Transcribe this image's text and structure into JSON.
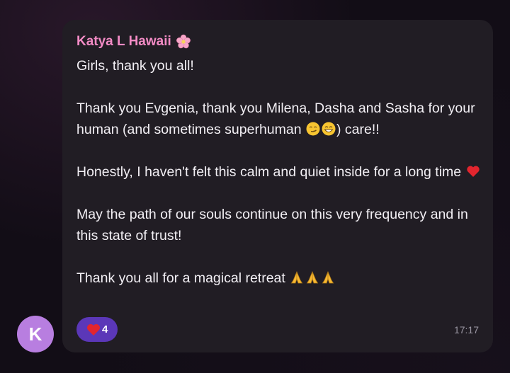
{
  "message": {
    "sender": "Katya L Hawaii",
    "sender_color": "#f38bc5",
    "sender_emoji_icon": "cherry-blossom-icon",
    "avatar_letter": "K",
    "avatar_color": "#b87ee0",
    "paragraphs": {
      "p1": "Girls, thank you all!",
      "p2a": "Thank you Evgenia, thank you Milena, Dasha and Sasha for your human (and sometimes superhuman ",
      "p2b": ") care!!",
      "p3a": "Honestly, I haven't felt this calm and quiet inside for a long time ",
      "p4": "May the path of our souls continue on this very frequency and in this state of trust!",
      "p5a": "Thank you all for a magical retreat "
    },
    "inline_icons": [
      "smirk-face-icon",
      "grinning-face-icon",
      "red-heart-icon",
      "folded-hands-icon"
    ],
    "reaction": {
      "icon": "red-heart-icon",
      "count": "4",
      "color": "#5b37b8"
    },
    "time": "17:17"
  }
}
